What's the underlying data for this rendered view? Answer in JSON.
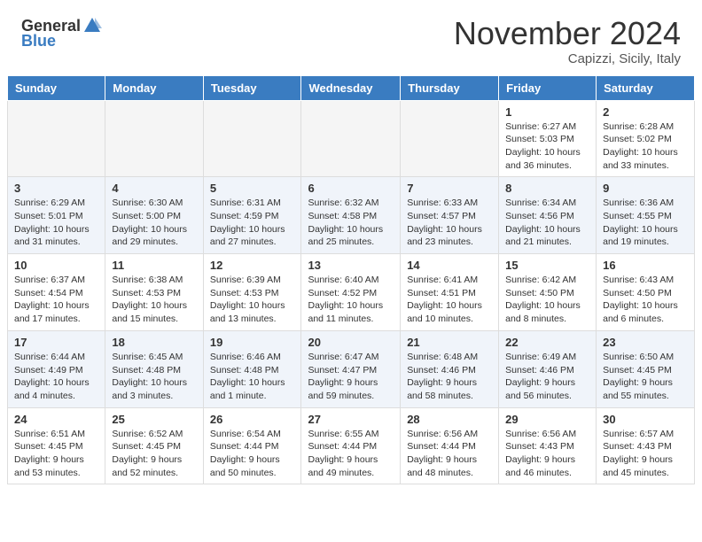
{
  "header": {
    "logo_general": "General",
    "logo_blue": "Blue",
    "month_title": "November 2024",
    "subtitle": "Capizzi, Sicily, Italy"
  },
  "days_of_week": [
    "Sunday",
    "Monday",
    "Tuesday",
    "Wednesday",
    "Thursday",
    "Friday",
    "Saturday"
  ],
  "weeks": [
    [
      {
        "day": "",
        "info": ""
      },
      {
        "day": "",
        "info": ""
      },
      {
        "day": "",
        "info": ""
      },
      {
        "day": "",
        "info": ""
      },
      {
        "day": "",
        "info": ""
      },
      {
        "day": "1",
        "info": "Sunrise: 6:27 AM\nSunset: 5:03 PM\nDaylight: 10 hours and 36 minutes."
      },
      {
        "day": "2",
        "info": "Sunrise: 6:28 AM\nSunset: 5:02 PM\nDaylight: 10 hours and 33 minutes."
      }
    ],
    [
      {
        "day": "3",
        "info": "Sunrise: 6:29 AM\nSunset: 5:01 PM\nDaylight: 10 hours and 31 minutes."
      },
      {
        "day": "4",
        "info": "Sunrise: 6:30 AM\nSunset: 5:00 PM\nDaylight: 10 hours and 29 minutes."
      },
      {
        "day": "5",
        "info": "Sunrise: 6:31 AM\nSunset: 4:59 PM\nDaylight: 10 hours and 27 minutes."
      },
      {
        "day": "6",
        "info": "Sunrise: 6:32 AM\nSunset: 4:58 PM\nDaylight: 10 hours and 25 minutes."
      },
      {
        "day": "7",
        "info": "Sunrise: 6:33 AM\nSunset: 4:57 PM\nDaylight: 10 hours and 23 minutes."
      },
      {
        "day": "8",
        "info": "Sunrise: 6:34 AM\nSunset: 4:56 PM\nDaylight: 10 hours and 21 minutes."
      },
      {
        "day": "9",
        "info": "Sunrise: 6:36 AM\nSunset: 4:55 PM\nDaylight: 10 hours and 19 minutes."
      }
    ],
    [
      {
        "day": "10",
        "info": "Sunrise: 6:37 AM\nSunset: 4:54 PM\nDaylight: 10 hours and 17 minutes."
      },
      {
        "day": "11",
        "info": "Sunrise: 6:38 AM\nSunset: 4:53 PM\nDaylight: 10 hours and 15 minutes."
      },
      {
        "day": "12",
        "info": "Sunrise: 6:39 AM\nSunset: 4:53 PM\nDaylight: 10 hours and 13 minutes."
      },
      {
        "day": "13",
        "info": "Sunrise: 6:40 AM\nSunset: 4:52 PM\nDaylight: 10 hours and 11 minutes."
      },
      {
        "day": "14",
        "info": "Sunrise: 6:41 AM\nSunset: 4:51 PM\nDaylight: 10 hours and 10 minutes."
      },
      {
        "day": "15",
        "info": "Sunrise: 6:42 AM\nSunset: 4:50 PM\nDaylight: 10 hours and 8 minutes."
      },
      {
        "day": "16",
        "info": "Sunrise: 6:43 AM\nSunset: 4:50 PM\nDaylight: 10 hours and 6 minutes."
      }
    ],
    [
      {
        "day": "17",
        "info": "Sunrise: 6:44 AM\nSunset: 4:49 PM\nDaylight: 10 hours and 4 minutes."
      },
      {
        "day": "18",
        "info": "Sunrise: 6:45 AM\nSunset: 4:48 PM\nDaylight: 10 hours and 3 minutes."
      },
      {
        "day": "19",
        "info": "Sunrise: 6:46 AM\nSunset: 4:48 PM\nDaylight: 10 hours and 1 minute."
      },
      {
        "day": "20",
        "info": "Sunrise: 6:47 AM\nSunset: 4:47 PM\nDaylight: 9 hours and 59 minutes."
      },
      {
        "day": "21",
        "info": "Sunrise: 6:48 AM\nSunset: 4:46 PM\nDaylight: 9 hours and 58 minutes."
      },
      {
        "day": "22",
        "info": "Sunrise: 6:49 AM\nSunset: 4:46 PM\nDaylight: 9 hours and 56 minutes."
      },
      {
        "day": "23",
        "info": "Sunrise: 6:50 AM\nSunset: 4:45 PM\nDaylight: 9 hours and 55 minutes."
      }
    ],
    [
      {
        "day": "24",
        "info": "Sunrise: 6:51 AM\nSunset: 4:45 PM\nDaylight: 9 hours and 53 minutes."
      },
      {
        "day": "25",
        "info": "Sunrise: 6:52 AM\nSunset: 4:45 PM\nDaylight: 9 hours and 52 minutes."
      },
      {
        "day": "26",
        "info": "Sunrise: 6:54 AM\nSunset: 4:44 PM\nDaylight: 9 hours and 50 minutes."
      },
      {
        "day": "27",
        "info": "Sunrise: 6:55 AM\nSunset: 4:44 PM\nDaylight: 9 hours and 49 minutes."
      },
      {
        "day": "28",
        "info": "Sunrise: 6:56 AM\nSunset: 4:44 PM\nDaylight: 9 hours and 48 minutes."
      },
      {
        "day": "29",
        "info": "Sunrise: 6:56 AM\nSunset: 4:43 PM\nDaylight: 9 hours and 46 minutes."
      },
      {
        "day": "30",
        "info": "Sunrise: 6:57 AM\nSunset: 4:43 PM\nDaylight: 9 hours and 45 minutes."
      }
    ]
  ]
}
